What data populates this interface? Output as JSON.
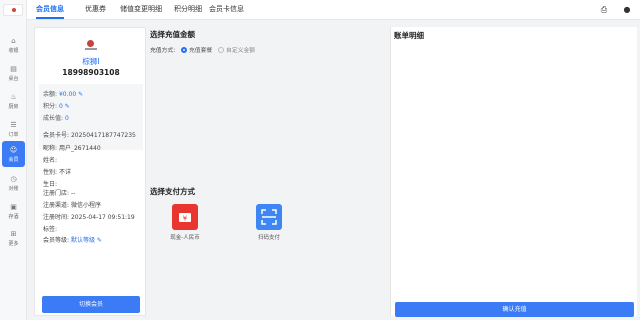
{
  "sidebar": {
    "items": [
      {
        "label": "收银",
        "icon": "cashier-icon"
      },
      {
        "label": "桌台",
        "icon": "table-icon"
      },
      {
        "label": "厨房",
        "icon": "kitchen-icon"
      },
      {
        "label": "订单",
        "icon": "order-icon"
      },
      {
        "label": "会员",
        "icon": "member-icon",
        "active": true
      },
      {
        "label": "对账",
        "icon": "reconcile-icon"
      },
      {
        "label": "存酒",
        "icon": "storage-icon"
      },
      {
        "label": "更多",
        "icon": "more-icon"
      }
    ]
  },
  "tabs": [
    {
      "label": "会员信息",
      "active": true
    },
    {
      "label": "优惠券"
    },
    {
      "label": "储值变更明细"
    },
    {
      "label": "积分明细"
    },
    {
      "label": "会员卡信息"
    }
  ],
  "member": {
    "name": "棕狮Ⅰ",
    "phone": "18998903108",
    "balance_label": "余额:",
    "balance_value": "¥0.00",
    "points_label": "积分:",
    "points_value": "0",
    "growth_label": "成长值:",
    "growth_value": "0",
    "card_no_label": "会员卡号:",
    "card_no": "20250417187747235",
    "nickname_label": "昵称:",
    "nickname": "用户_2671440",
    "realname_label": "姓名:",
    "gender_label": "性别:",
    "gender": "不详",
    "birthday_label": "生日:",
    "store_label": "注册门店:",
    "store": "--",
    "channel_label": "注册渠道:",
    "channel": "微信小程序",
    "reg_time_label": "注册时间:",
    "reg_time": "2025-04-17 09:51:19",
    "tags_label": "标签:",
    "level_label": "会员等级:",
    "level": "默认等级",
    "switch_button": "切换会员"
  },
  "recharge": {
    "title": "选择充值金额",
    "mode_label": "充值方式:",
    "mode_options": [
      "充值套餐",
      "自定义金额"
    ],
    "pay_title": "选择支付方式",
    "pay_methods": [
      {
        "label": "现金-人民币",
        "icon": "cash-icon",
        "color": "#e8352f"
      },
      {
        "label": "扫码支付",
        "icon": "scan-pay-icon",
        "color": "#3d86f4"
      }
    ]
  },
  "bill": {
    "title": "账单明细",
    "confirm_button": "确认充值"
  },
  "colors": {
    "accent": "#3b7bf5"
  }
}
